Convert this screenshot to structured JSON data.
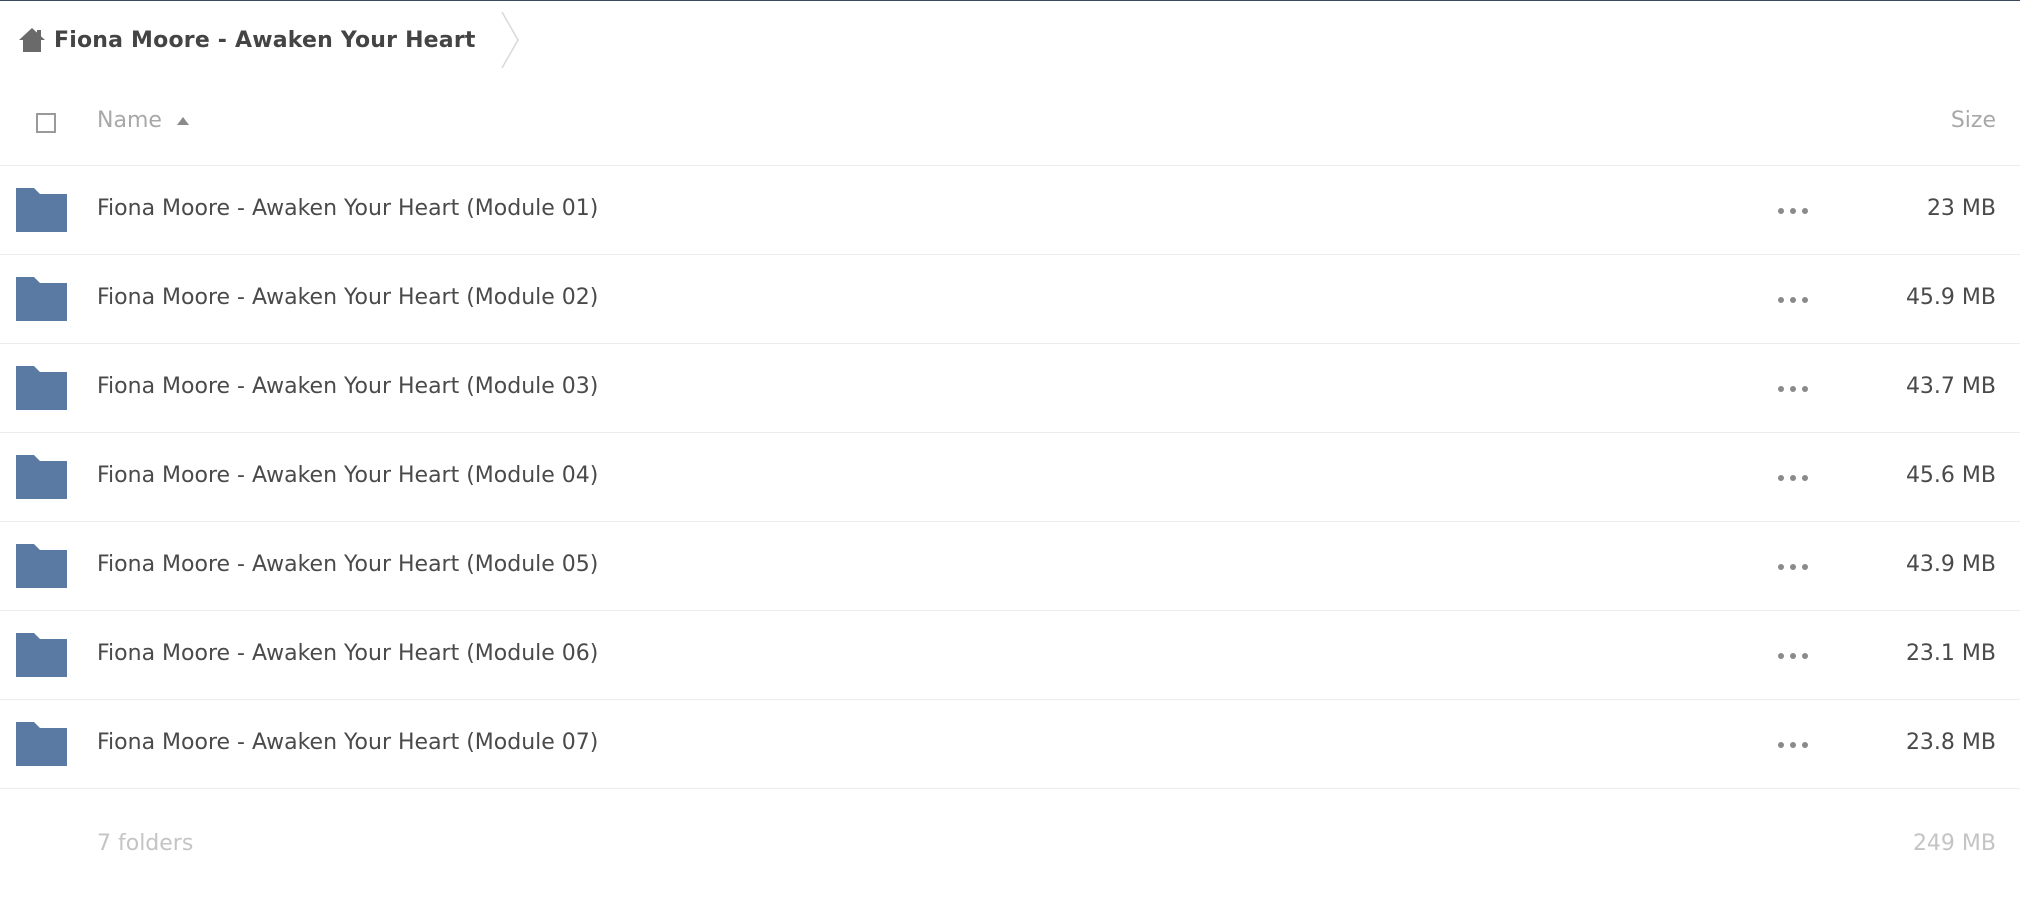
{
  "breadcrumb": {
    "icon": "home-icon",
    "label": "Fiona Moore - Awaken Your Heart"
  },
  "table": {
    "columns": {
      "name": "Name",
      "size": "Size",
      "sort": "ascending"
    },
    "rows": [
      {
        "name": "Fiona Moore - Awaken Your Heart (Module 01)",
        "size": "23 MB",
        "icon": "folder-icon"
      },
      {
        "name": "Fiona Moore - Awaken Your Heart (Module 02)",
        "size": "45.9 MB",
        "icon": "folder-icon"
      },
      {
        "name": "Fiona Moore - Awaken Your Heart (Module 03)",
        "size": "43.7 MB",
        "icon": "folder-icon"
      },
      {
        "name": "Fiona Moore - Awaken Your Heart (Module 04)",
        "size": "45.6 MB",
        "icon": "folder-icon"
      },
      {
        "name": "Fiona Moore - Awaken Your Heart (Module 05)",
        "size": "43.9 MB",
        "icon": "folder-icon"
      },
      {
        "name": "Fiona Moore - Awaken Your Heart (Module 06)",
        "size": "23.1 MB",
        "icon": "folder-icon"
      },
      {
        "name": "Fiona Moore - Awaken Your Heart (Module 07)",
        "size": "23.8 MB",
        "icon": "folder-icon"
      }
    ],
    "summary": {
      "count": "7 folders",
      "total_size": "249 MB"
    }
  },
  "colors": {
    "folder": "#5b7aa3",
    "header_text": "#a8a8a8",
    "row_text": "#4a4a4a",
    "summary_text": "#c4c4c4"
  }
}
